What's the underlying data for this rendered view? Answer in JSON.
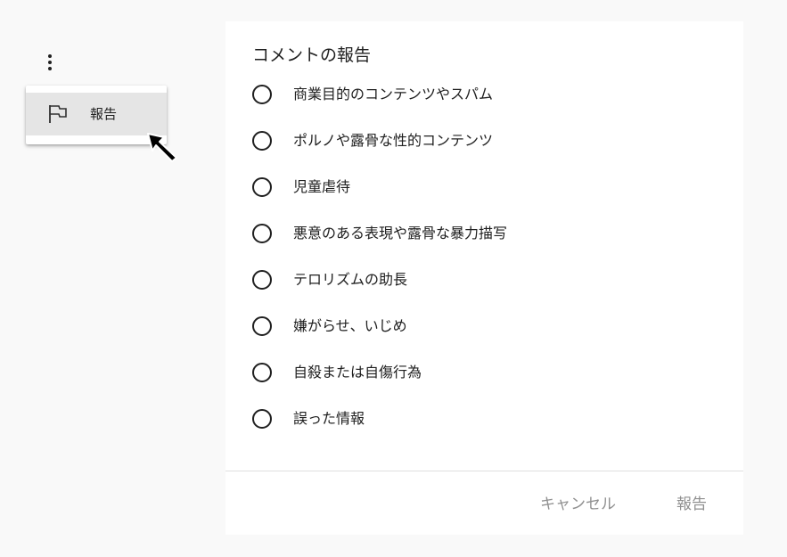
{
  "menu": {
    "report_label": "報告"
  },
  "dialog": {
    "title": "コメントの報告",
    "options": [
      "商業目的のコンテンツやスパム",
      "ポルノや露骨な性的コンテンツ",
      "児童虐待",
      "悪意のある表現や露骨な暴力描写",
      "テロリズムの助長",
      "嫌がらせ、いじめ",
      "自殺または自傷行為",
      "誤った情報"
    ],
    "cancel_label": "キャンセル",
    "report_label": "報告"
  },
  "icons": {
    "kebab": "more-vert-icon",
    "flag": "flag-icon",
    "cursor": "mouse-cursor-icon"
  },
  "colors": {
    "text": "#202020",
    "menu_highlight": "#e5e5e5",
    "disabled_button": "#909090",
    "background": "#f9f9f9"
  }
}
